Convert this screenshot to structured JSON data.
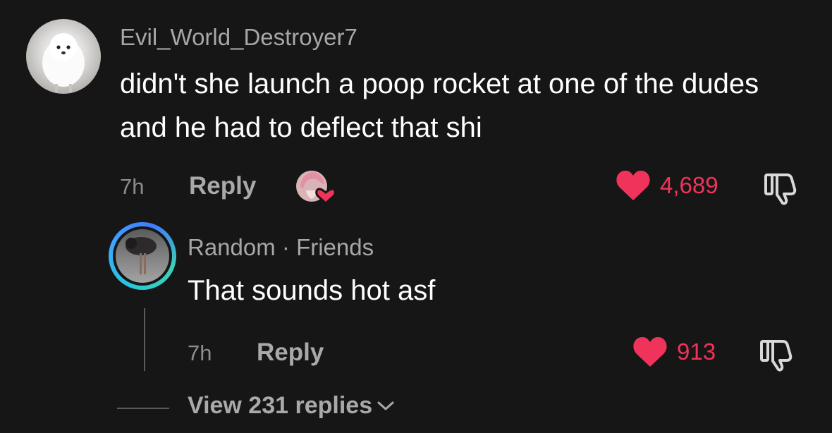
{
  "comment": {
    "username": "Evil_World_Destroyer7",
    "text": "didn't she launch a poop rocket at one of the dudes and he had to deflect that shi",
    "time": "7h",
    "reply_label": "Reply",
    "likes": "4,689",
    "avatar": "white-dog-avatar",
    "creator_liked_icon": "creator-liked-heart-icon"
  },
  "reply": {
    "username": "Random",
    "separator": "·",
    "relation": "Friends",
    "text": "That sounds hot asf",
    "time": "7h",
    "reply_label": "Reply",
    "likes": "913",
    "avatar": "bird-avatar"
  },
  "view_replies": {
    "label": "View 231 replies"
  },
  "colors": {
    "background": "#161616",
    "like_red": "#f0335a",
    "muted_text": "#a7a7a7",
    "ring_start": "#27c8d8",
    "ring_end": "#3f7bff"
  }
}
